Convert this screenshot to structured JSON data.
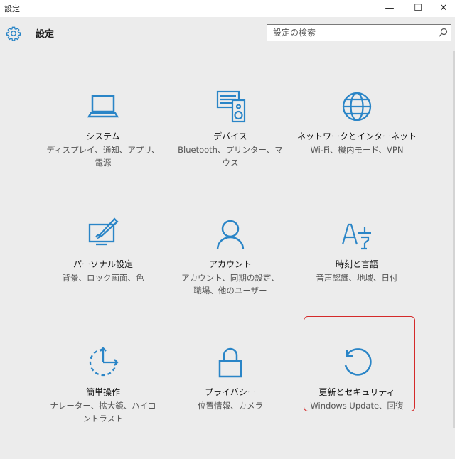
{
  "window": {
    "title": "設定",
    "minimize": "—",
    "maximize": "☐",
    "close": "✕"
  },
  "header": {
    "title": "設定",
    "search_placeholder": "設定の検索"
  },
  "colors": {
    "accent": "#2a85c7",
    "highlight_border": "#d42a2a"
  },
  "tiles": [
    {
      "icon": "laptop-icon",
      "label": "システム",
      "desc": [
        "ディスプレイ、通知、アプリ、",
        "電源"
      ]
    },
    {
      "icon": "devices-icon",
      "label": "デバイス",
      "desc": [
        "Bluetooth、プリンター、マ",
        "ウス"
      ]
    },
    {
      "icon": "globe-icon",
      "label": "ネットワークとインターネット",
      "desc": [
        "Wi-Fi、機内モード、VPN"
      ]
    },
    {
      "icon": "personalization-icon",
      "label": "パーソナル設定",
      "desc": [
        "背景、ロック画面、色"
      ]
    },
    {
      "icon": "person-icon",
      "label": "アカウント",
      "desc": [
        "アカウント、同期の設定、",
        "職場、他のユーザー"
      ]
    },
    {
      "icon": "time-language-icon",
      "label": "時刻と言語",
      "desc": [
        "音声認識、地域、日付"
      ]
    },
    {
      "icon": "ease-of-access-icon",
      "label": "簡単操作",
      "desc": [
        "ナレーター、拡大鏡、ハイコ",
        "ントラスト"
      ]
    },
    {
      "icon": "lock-icon",
      "label": "プライバシー",
      "desc": [
        "位置情報、カメラ"
      ]
    },
    {
      "icon": "update-icon",
      "label": "更新とセキュリティ",
      "desc": [
        "Windows Update、回復"
      ]
    }
  ]
}
